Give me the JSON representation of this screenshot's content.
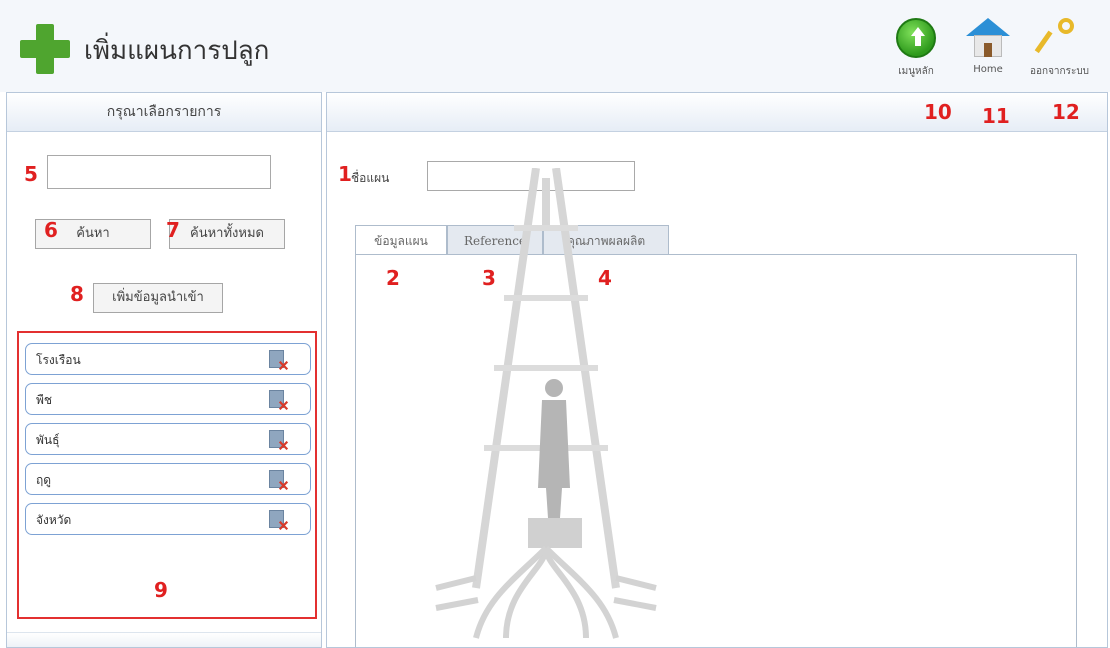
{
  "header": {
    "title": "เพิ่มแผนการปลูก",
    "buttons": [
      {
        "label": "เมนูหลัก",
        "icon": "up-arrow-icon"
      },
      {
        "label": "Home",
        "icon": "home-icon"
      },
      {
        "label": "ออกจากระบบ",
        "icon": "key-icon"
      }
    ]
  },
  "left_panel": {
    "title": "กรุณาเลือกรายการ",
    "search_value": "",
    "search_button": "ค้นหา",
    "search_all_button": "ค้นหาทั้งหมด",
    "add_import_button": "เพิ่มข้อมูลนำเข้า",
    "items": [
      {
        "label": "โรงเรือน"
      },
      {
        "label": "พืช"
      },
      {
        "label": "พันธุ์"
      },
      {
        "label": "ฤดู"
      },
      {
        "label": "จังหวัด"
      }
    ]
  },
  "right_panel": {
    "name_label": "ชื่อแผน",
    "name_value": "",
    "tabs": [
      {
        "label": "ข้อมูลแผน"
      },
      {
        "label": "Reference"
      },
      {
        "label": "คุณภาพผลผลิต"
      }
    ]
  },
  "annotations": [
    "1",
    "2",
    "3",
    "4",
    "5",
    "6",
    "7",
    "8",
    "9",
    "10",
    "11",
    "12"
  ],
  "colors": {
    "annotation": "#e02020",
    "header_bg": "#f4f7fb",
    "panel_border": "#b7c7da",
    "list_border": "#e33030",
    "plus_green": "#4fa52f"
  }
}
